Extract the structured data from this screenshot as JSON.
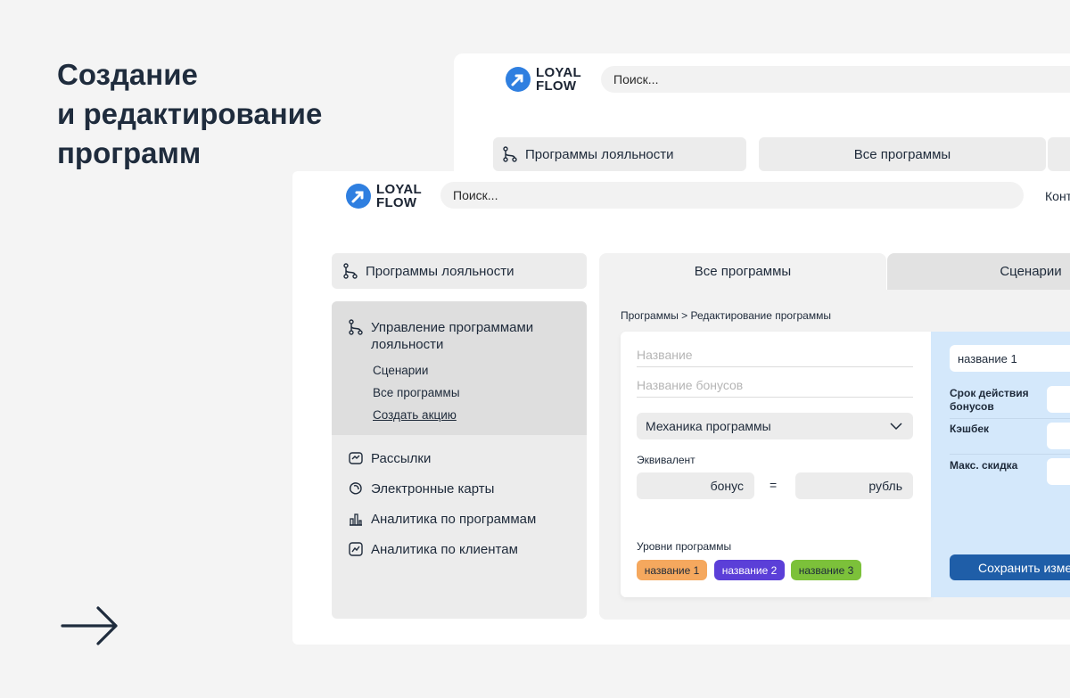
{
  "headline": {
    "line1": "Создание",
    "line2": "и редактирование",
    "line3": "программ"
  },
  "back_window": {
    "logo_line1": "LOYAL",
    "logo_line2": "FLOW",
    "search_placeholder": "Поиск...",
    "nav_loyalty": "Программы лояльности",
    "tab_all": "Все программы"
  },
  "header": {
    "logo_line1": "LOYAL",
    "logo_line2": "FLOW",
    "search_placeholder": "Поиск...",
    "contacts": "Конт"
  },
  "sidebar": {
    "head": "Программы лояльности",
    "group_title": "Управление программами лояльности",
    "sub_items": [
      "Сценарии",
      "Все программы",
      "Создать акцию"
    ],
    "items": [
      "Рассылки",
      "Электронные карты",
      "Аналитика по программам",
      "Аналитика по клиентам"
    ]
  },
  "tabs": {
    "all": "Все программы",
    "scenarios": "Сценарии"
  },
  "breadcrumb": "Программы > Редактирование программы",
  "form": {
    "name_placeholder": "Название",
    "bonus_name_placeholder": "Название бонусов",
    "mechanics_select": "Механика программы",
    "equivalent_label": "Эквивалент",
    "equivalent_left": "бонус",
    "equals": "=",
    "equivalent_right": "рубль",
    "levels_label": "Уровни программы",
    "levels": [
      "название 1",
      "название 2",
      "название 3"
    ],
    "level_colors": [
      "#f5a85e",
      "#5b3fd8",
      "#7cc13a"
    ]
  },
  "panel": {
    "level_name": "название 1",
    "bonus_validity": "Срок действия бонусов",
    "cashback": "Кэшбек",
    "max_discount": "Макс. скидка",
    "save_button": "Сохранить изме"
  },
  "colors": {
    "accent": "#1f5ea8",
    "logo": "#2f7fe0",
    "panel_bg": "#d4e8fb"
  }
}
